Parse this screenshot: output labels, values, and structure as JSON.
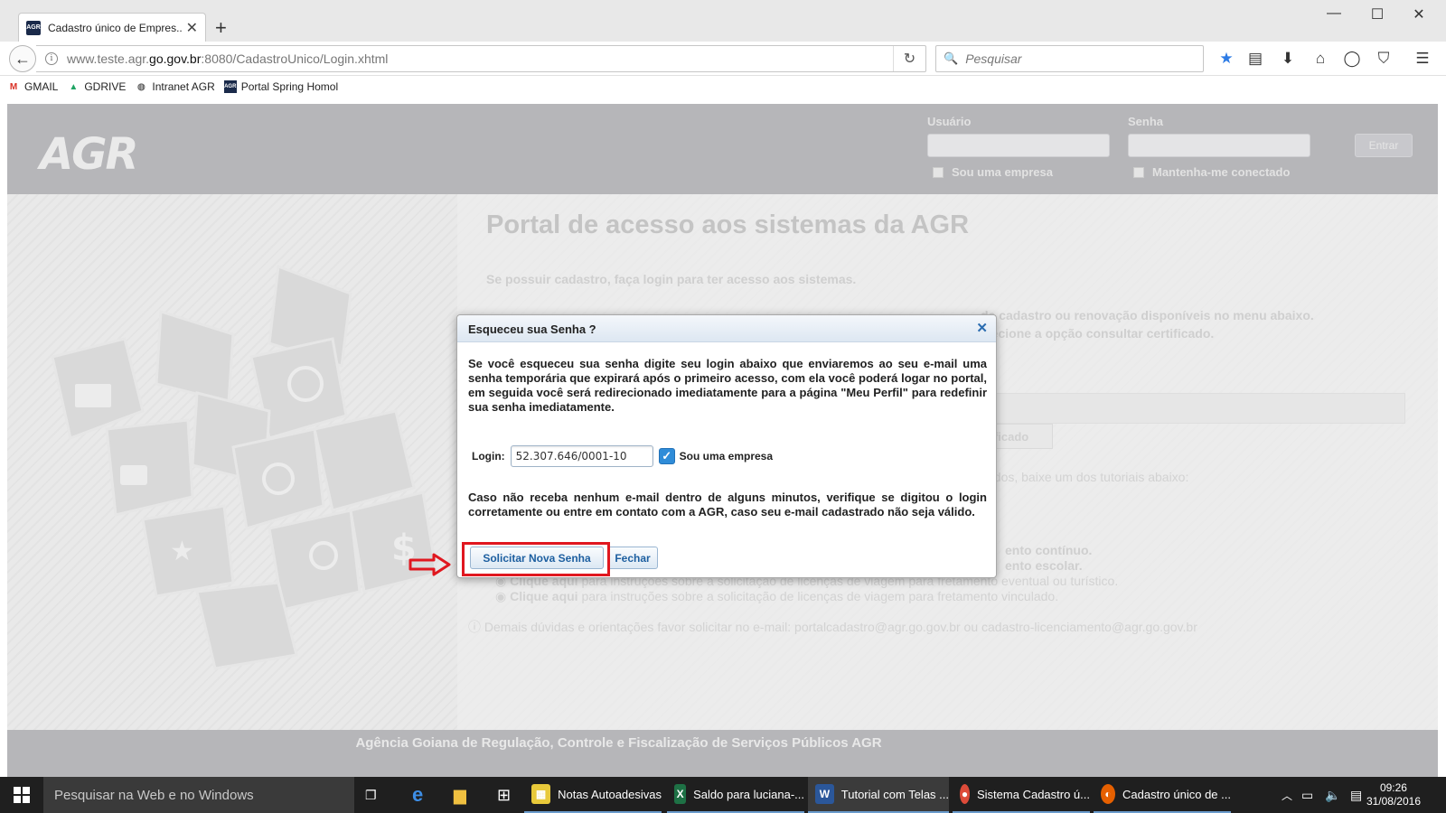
{
  "browser": {
    "tab_title": "Cadastro único de Empres...",
    "favicon_text": "AGR",
    "url_prefix": "www.teste.agr.",
    "url_domain": "go.gov.br",
    "url_suffix": ":8080/CadastroUnico/Login.xhtml",
    "search_placeholder": "Pesquisar",
    "bookmarks": [
      {
        "label": "GMAIL",
        "icon": "gmail-icon"
      },
      {
        "label": "GDRIVE",
        "icon": "gdrive-icon"
      },
      {
        "label": "Intranet AGR",
        "icon": "globe-icon"
      },
      {
        "label": "Portal Spring Homol",
        "icon": "agr-icon"
      }
    ]
  },
  "header": {
    "logo": "AGR",
    "user_label": "Usuário",
    "password_label": "Senha",
    "enter_button": "Entrar",
    "company_check": "Sou uma empresa",
    "remember_check": "Mantenha-me conectado"
  },
  "content": {
    "title": "Portal de acesso aos sistemas da AGR",
    "intro": "Se possuir cadastro, faça login para ter acesso aos sistemas.",
    "line1": "de cadastro ou renovação disponíveis no menu abaixo.",
    "line2": "elecione a opção consultar certificado.",
    "tab_label": "tificado",
    "tutorials_line": "cados, baixe um dos tutoriais abaixo:",
    "link_line1": "ento contínuo.",
    "link_line2": "ento escolar.",
    "link3_prefix": "Clique aqui",
    "link3_rest": " para instruções sobre a solicitação de licenças de viagem para fretamento eventual ou turístico.",
    "link4_prefix": "Clique aqui",
    "link4_rest": " para instruções sobre a solicitação de licenças de viagem para fretamento vinculado.",
    "contact_line": "Demais dúvidas e orientações favor solicitar no e-mail: portalcadastro@agr.go.gov.br ou cadastro-licenciamento@agr.go.gov.br"
  },
  "footer": {
    "text": "Agência Goiana de Regulação, Controle e Fiscalização de Serviços Públicos   AGR"
  },
  "modal": {
    "title": "Esqueceu sua Senha ?",
    "message": "Se você esqueceu sua senha digite seu login abaixo que enviaremos ao seu e-mail uma senha temporária que expirará após o primeiro acesso, com ela você poderá logar no portal, em seguida você será redirecionado imediatamente para a página \"Meu Perfil\" para redefinir sua senha imediatamente.",
    "login_label": "Login:",
    "login_value": "52.307.646/0001-10",
    "company_checkbox_label": "Sou uma empresa",
    "company_checked": true,
    "note": "Caso não receba nenhum e-mail dentro de alguns minutos, verifique se digitou o login corretamente ou entre em contato com a AGR, caso seu e-mail cadastrado não seja válido.",
    "submit_button": "Solicitar Nova Senha",
    "close_button": "Fechar"
  },
  "taskbar": {
    "search_placeholder": "Pesquisar na Web e no Windows",
    "apps": [
      {
        "label": "Notas Autoadesivas",
        "icon": "sticky-notes-icon",
        "color": "#e8c93a"
      },
      {
        "label": "Saldo para luciana-...",
        "icon": "excel-icon",
        "color": "#1e7145"
      },
      {
        "label": "Tutorial com Telas ...",
        "icon": "word-icon",
        "color": "#2b579a"
      },
      {
        "label": "Sistema Cadastro ú...",
        "icon": "chrome-icon",
        "color": "#dd4b39"
      },
      {
        "label": "Cadastro único de ...",
        "icon": "firefox-icon",
        "color": "#e66000"
      }
    ],
    "time": "09:26",
    "date": "31/08/2016"
  },
  "colors": {
    "accent": "#2f8cd8",
    "highlight": "#e0171f",
    "header_gray": "#b6b6b9"
  }
}
